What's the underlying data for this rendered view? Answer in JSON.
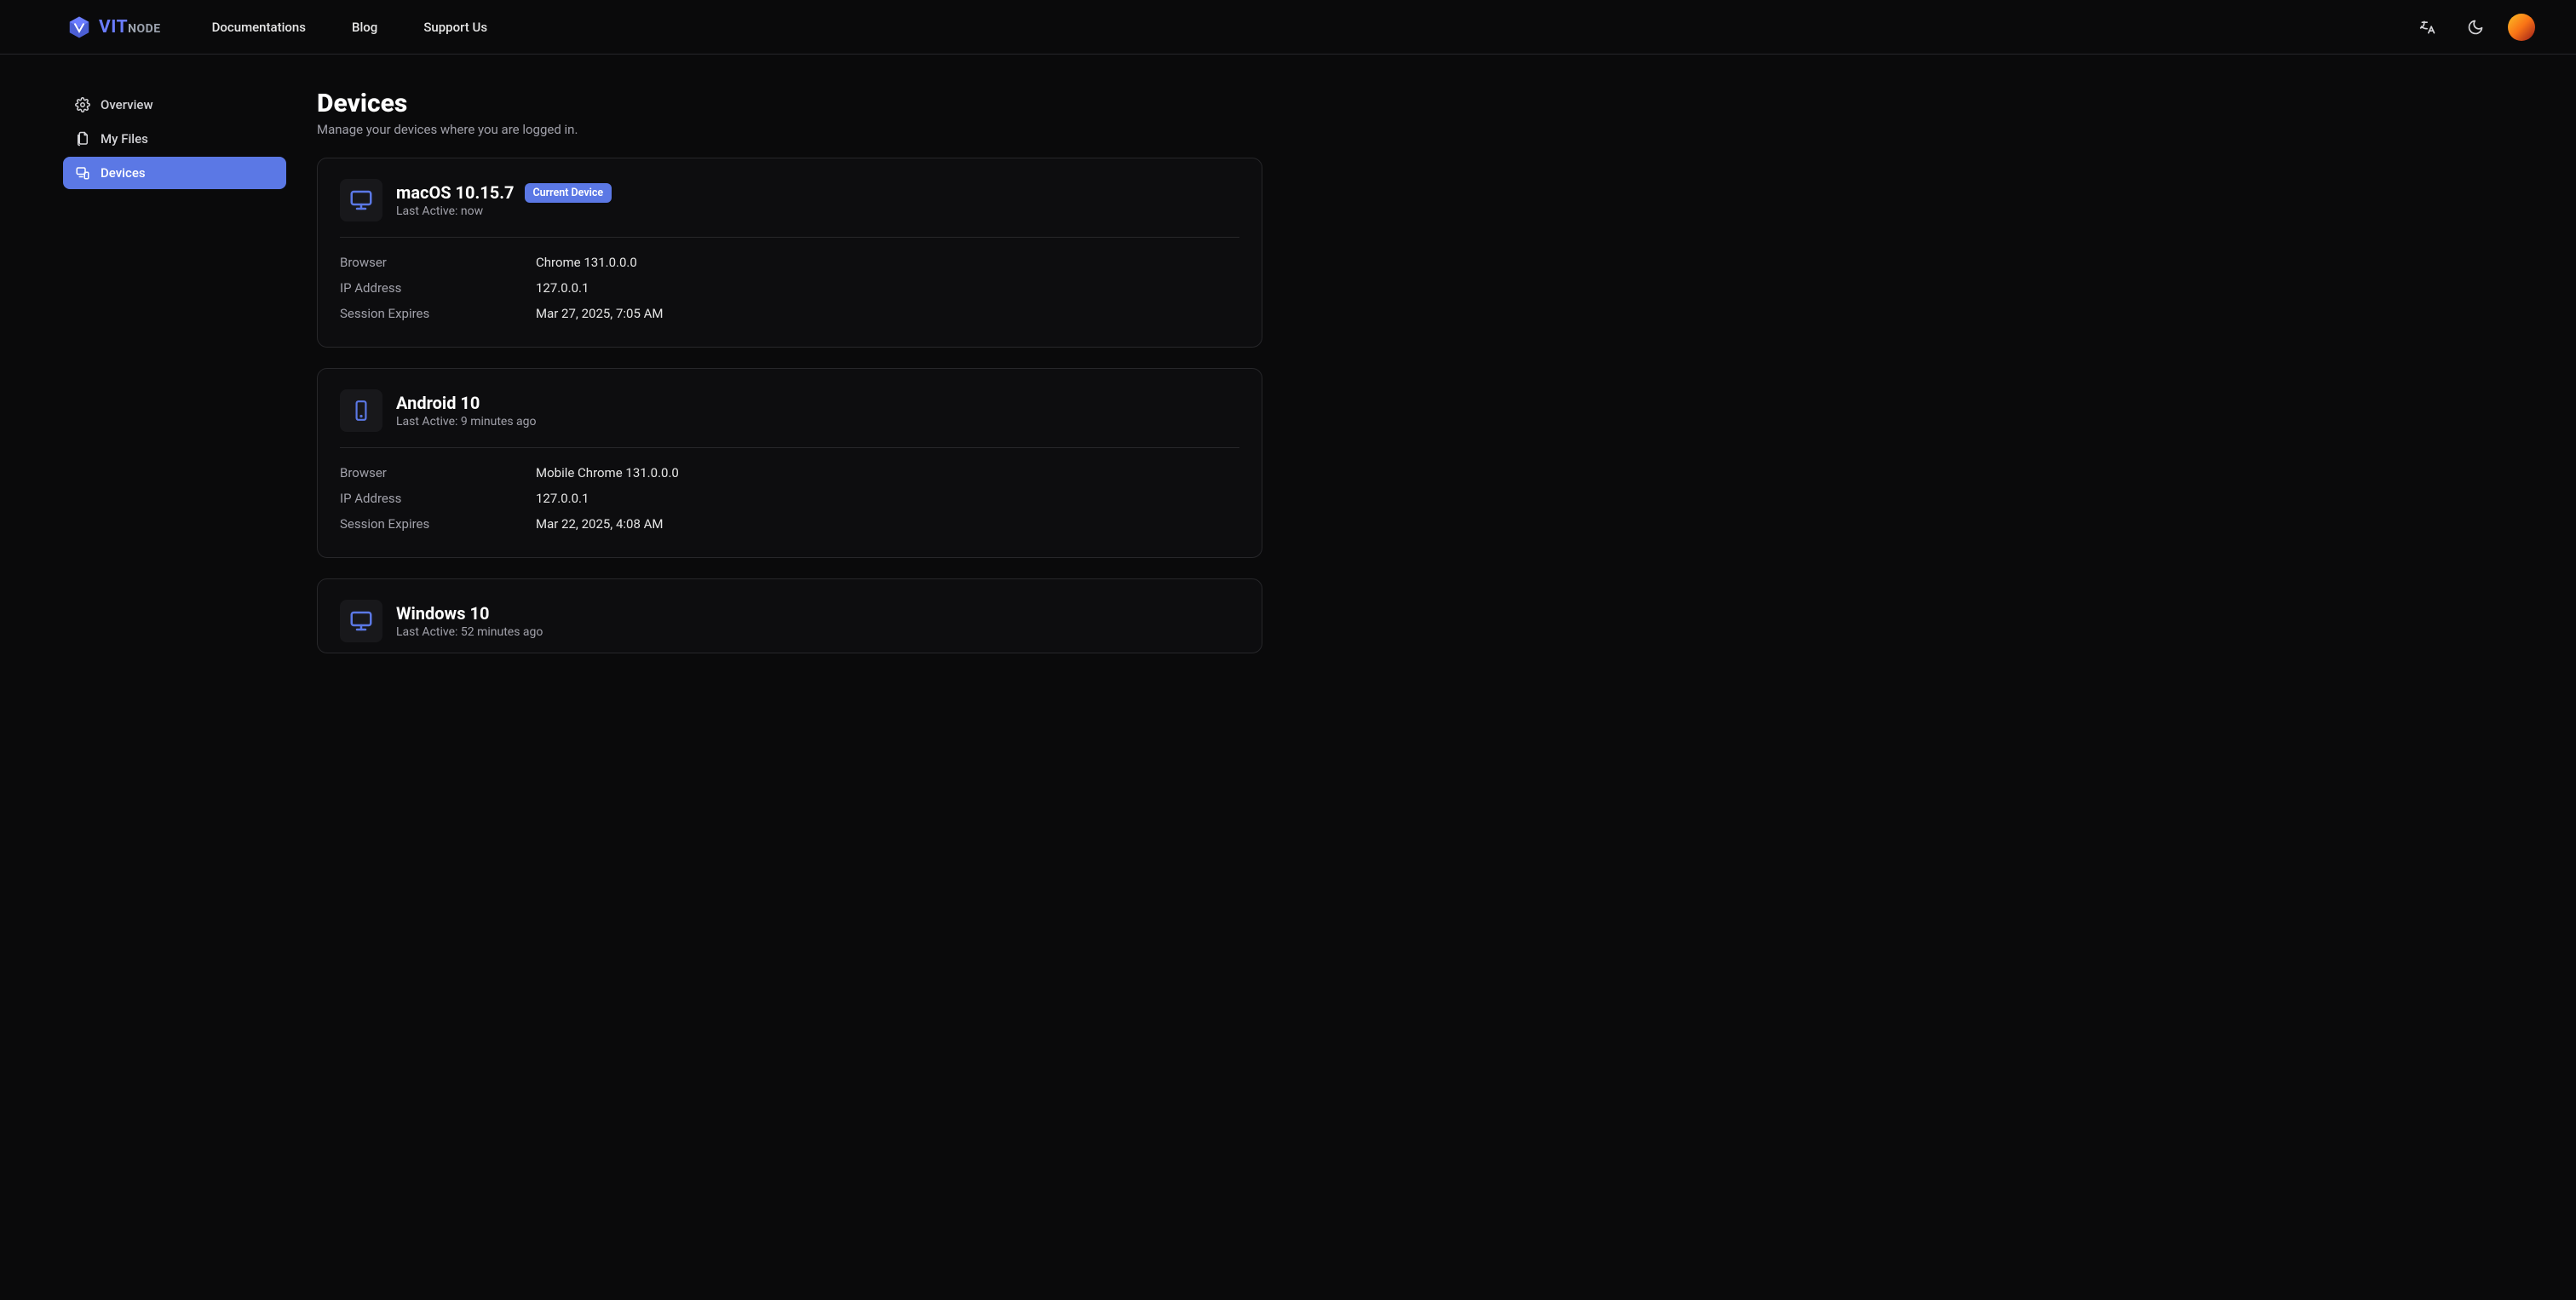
{
  "brand": {
    "vit": "VIT",
    "node": "NODE"
  },
  "nav": {
    "documentations": "Documentations",
    "blog": "Blog",
    "support_us": "Support Us"
  },
  "sidebar": {
    "overview": "Overview",
    "my_files": "My Files",
    "devices": "Devices"
  },
  "page": {
    "title": "Devices",
    "subtitle": "Manage your devices where you are logged in."
  },
  "labels": {
    "browser": "Browser",
    "ip": "IP Address",
    "session_expires": "Session Expires",
    "current_device": "Current Device",
    "last_active_prefix": "Last Active: "
  },
  "devices": [
    {
      "name": "macOS 10.15.7",
      "last_active": "now",
      "current": true,
      "kind": "desktop",
      "browser": "Chrome 131.0.0.0",
      "ip": "127.0.0.1",
      "session_expires": "Mar 27, 2025, 7:05 AM"
    },
    {
      "name": "Android 10",
      "last_active": "9 minutes ago",
      "current": false,
      "kind": "mobile",
      "browser": "Mobile Chrome 131.0.0.0",
      "ip": "127.0.0.1",
      "session_expires": "Mar 22, 2025, 4:08 AM"
    },
    {
      "name": "Windows 10",
      "last_active": "52 minutes ago",
      "current": false,
      "kind": "desktop",
      "browser": "",
      "ip": "",
      "session_expires": ""
    }
  ]
}
